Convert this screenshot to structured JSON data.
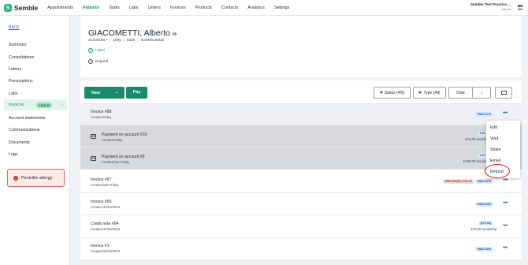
{
  "app": {
    "logo_mark": "S",
    "logo_text": "Semble",
    "practice_name": "Semble Test Practice ...",
    "practice_user": "ola.ola"
  },
  "nav": [
    {
      "label": "Appointments"
    },
    {
      "label": "Patients"
    },
    {
      "label": "Tasks"
    },
    {
      "label": "Labs"
    },
    {
      "label": "Letters"
    },
    {
      "label": "Invoices"
    },
    {
      "label": "Products"
    },
    {
      "label": "Contacts"
    },
    {
      "label": "Analytics"
    },
    {
      "label": "Settings"
    }
  ],
  "sidebar": {
    "back": "BACK",
    "items": [
      {
        "label": "Summary"
      },
      {
        "label": "Consultations"
      },
      {
        "label": "Letters"
      },
      {
        "label": "Prescriptions"
      },
      {
        "label": "Labs"
      },
      {
        "label": "Invoices",
        "badge": "£165.00"
      },
      {
        "label": "Account statements"
      },
      {
        "label": "Communications"
      },
      {
        "label": "Documents"
      },
      {
        "label": "Logs"
      }
    ],
    "allergy": "Penicillin allergy"
  },
  "patient": {
    "name": "GIACOMETTI, Alberto",
    "title": "Mr",
    "dob": "21/10/1917",
    "age": "105y",
    "sex": "Male",
    "id": "SS9N6L80DZ",
    "label_link": "Label",
    "expand_link": "Expand"
  },
  "toolbar": {
    "new_label": "New",
    "pay_label": "Pay",
    "status_filter": "Status (4/5)",
    "type_filter": "Type (All)",
    "date_label": "Date"
  },
  "rows": [
    {
      "title": "Invoice #88",
      "sub": "Created today",
      "tag": "PAID £170"
    },
    {
      "title": "Payment on account #10",
      "sub": "Created today",
      "tag": "£15",
      "note": "£15.00 remaini"
    },
    {
      "title": "Payment on account #9",
      "sub": "Created last Friday",
      "tag": "£10",
      "note": "£100.00 remaini"
    },
    {
      "title": "Invoice #87",
      "sub": "Created last Friday",
      "tag_refunded": "REFUNDED £150.00",
      "tag": "PAID £270"
    },
    {
      "title": "Invoice #65",
      "sub": "Created 20/03/2023",
      "tag": "PAID £100"
    },
    {
      "title": "Credit note #64",
      "sub": "Created 20/03/2023",
      "tag": "(£70.00)",
      "note": "£70.00 remaining"
    },
    {
      "title": "Invoice #1",
      "sub": "Created 06/10/2023",
      "tag": "PAID £350"
    }
  ],
  "menu": {
    "items": [
      {
        "label": "Edit"
      },
      {
        "label": "Void"
      },
      {
        "label": "Share"
      },
      {
        "label": "Email"
      },
      {
        "label": "Refund"
      }
    ]
  },
  "colors": {
    "accent": "#1b8a66",
    "highlight_ring": "#e0221b"
  }
}
